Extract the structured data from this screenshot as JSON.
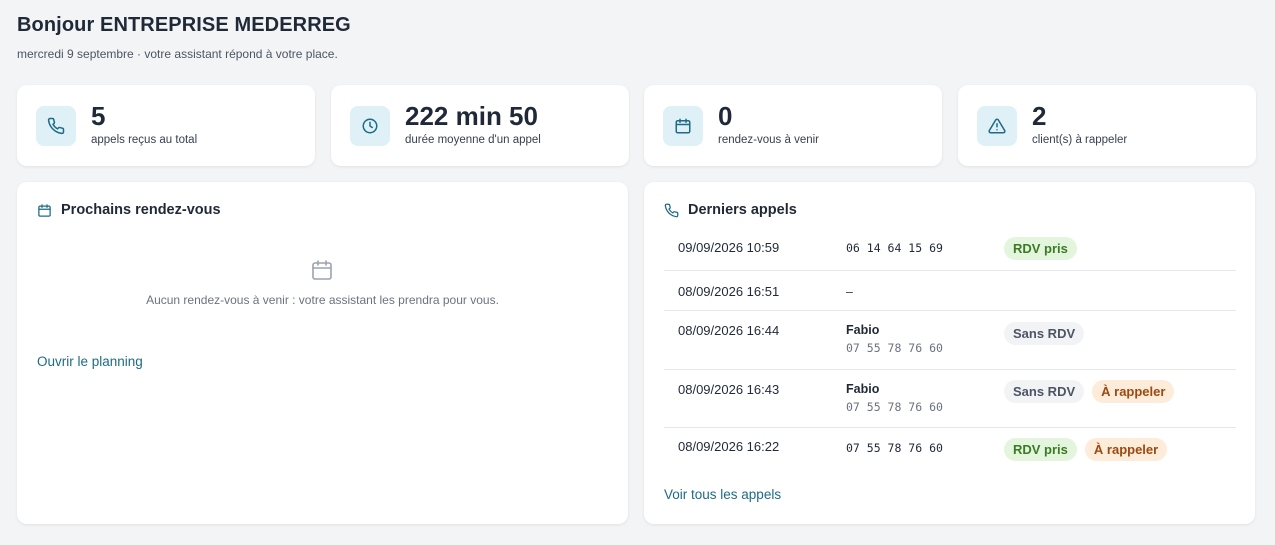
{
  "header": {
    "title": "Bonjour ENTREPRISE MEDERREG",
    "subtitle": "mercredi 9 septembre · votre assistant répond à votre place."
  },
  "stats": [
    {
      "icon": "phone-icon",
      "value": "5",
      "label": "appels reçus au total"
    },
    {
      "icon": "clock-icon",
      "value": "222 min 50",
      "label": "durée moyenne d'un appel"
    },
    {
      "icon": "calendar-icon",
      "value": "0",
      "label": "rendez-vous à venir"
    },
    {
      "icon": "warning-icon",
      "value": "2",
      "label": "client(s) à rappeler"
    }
  ],
  "appointments": {
    "title": "Prochains rendez-vous",
    "empty_text": "Aucun rendez-vous à venir : votre assistant les prendra pour vous.",
    "link": "Ouvrir le planning"
  },
  "calls": {
    "title": "Derniers appels",
    "link": "Voir tous les appels",
    "rows": [
      {
        "date": "09/09/2026 10:59",
        "name": "",
        "phone": "06 14 64 15 69",
        "tags": [
          "RDV pris"
        ]
      },
      {
        "date": "08/09/2026 16:51",
        "name": "",
        "phone": "—",
        "tags": []
      },
      {
        "date": "08/09/2026 16:44",
        "name": "Fabio",
        "phone": "07 55 78 76 60",
        "tags": [
          "Sans RDV"
        ]
      },
      {
        "date": "08/09/2026 16:43",
        "name": "Fabio",
        "phone": "07 55 78 76 60",
        "tags": [
          "Sans RDV",
          "À rappeler"
        ]
      },
      {
        "date": "08/09/2026 16:22",
        "name": "",
        "phone": "07 55 78 76 60",
        "tags": [
          "RDV pris",
          "À rappeler"
        ]
      }
    ]
  },
  "colors": {
    "accent": "#1d6b85",
    "icon_bg": "#dff0f7",
    "tag_rdv_bg": "#e3f5dd",
    "tag_rdv_fg": "#3d7a25",
    "tag_sans_bg": "#f1f3f5",
    "tag_sans_fg": "#4b5563",
    "tag_rappel_bg": "#fdecd9",
    "tag_rappel_fg": "#9a4a12"
  }
}
